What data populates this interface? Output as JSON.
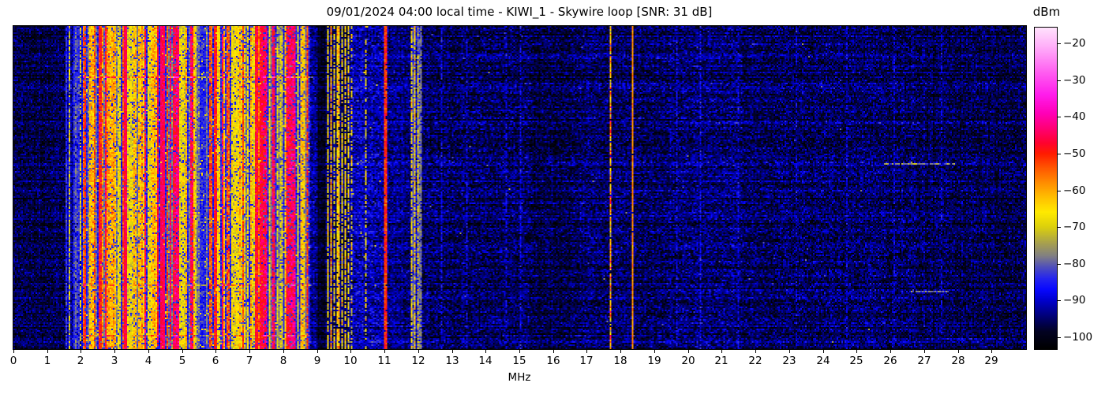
{
  "header": {
    "title": "09/01/2024 04:00 local time - KIWI_1 - Skywire loop [SNR: 31 dB]"
  },
  "chart_data": {
    "type": "heatmap",
    "title": "09/01/2024 04:00 local time - KIWI_1 - Skywire loop [SNR: 31 dB]",
    "subtitle": "",
    "xlabel": "MHz",
    "ylabel": "",
    "x_range": [
      0,
      30
    ],
    "x_ticks": [
      0,
      1,
      2,
      3,
      4,
      5,
      6,
      7,
      8,
      9,
      10,
      11,
      12,
      13,
      14,
      15,
      16,
      17,
      18,
      19,
      20,
      21,
      22,
      23,
      24,
      25,
      26,
      27,
      28,
      29
    ],
    "grid": false,
    "legend": "none",
    "colorbar": {
      "label": "dBm",
      "vmin": -103.2,
      "vmax": -15.7,
      "tick_values": [
        -20,
        -30,
        -40,
        -50,
        -60,
        -70,
        -80,
        -90,
        -100
      ],
      "tick_labels": [
        "−20",
        "−30",
        "−40",
        "−50",
        "−60",
        "−70",
        "−80",
        "−90",
        "−100"
      ]
    },
    "colormap_stops": [
      [
        -103.2,
        [
          0,
          0,
          0
        ]
      ],
      [
        -98.5,
        [
          2,
          2,
          34
        ]
      ],
      [
        -94,
        [
          0,
          0,
          125
        ]
      ],
      [
        -90,
        [
          0,
          0,
          205
        ]
      ],
      [
        -87,
        [
          8,
          8,
          255
        ]
      ],
      [
        -84,
        [
          38,
          38,
          238
        ]
      ],
      [
        -81,
        [
          78,
          78,
          188
        ]
      ],
      [
        -78,
        [
          128,
          126,
          132
        ]
      ],
      [
        -74,
        [
          172,
          165,
          72
        ]
      ],
      [
        -70,
        [
          220,
          208,
          12
        ]
      ],
      [
        -66,
        [
          255,
          234,
          0
        ]
      ],
      [
        -62,
        [
          255,
          192,
          0
        ]
      ],
      [
        -58,
        [
          255,
          142,
          0
        ]
      ],
      [
        -54,
        [
          255,
          88,
          0
        ]
      ],
      [
        -50,
        [
          255,
          28,
          0
        ]
      ],
      [
        -47,
        [
          255,
          2,
          48
        ]
      ],
      [
        -43,
        [
          255,
          0,
          118
        ]
      ],
      [
        -39,
        [
          255,
          0,
          183
        ]
      ],
      [
        -34,
        [
          255,
          28,
          235
        ]
      ],
      [
        -28,
        [
          255,
          92,
          240
        ]
      ],
      [
        -22,
        [
          255,
          162,
          248
        ]
      ],
      [
        -15.7,
        [
          255,
          226,
          252
        ]
      ]
    ],
    "seed": 1337,
    "bands": [
      {
        "f0": 0.0,
        "f1": 1.56,
        "kind": "noise",
        "base": -96.3,
        "noise": 3.1
      },
      {
        "f0": 1.56,
        "f1": 2.06,
        "kind": "cols",
        "base": -91,
        "noise": 3.2,
        "density": 0.5,
        "levels": [
          -86,
          -83,
          -80
        ]
      },
      {
        "f0": 2.06,
        "f1": 2.55,
        "kind": "busy",
        "density": 0.55,
        "hot": 0.4
      },
      {
        "f0": 2.55,
        "f1": 3.55,
        "kind": "busy",
        "density": 0.68,
        "hot": 0.7
      },
      {
        "f0": 3.55,
        "f1": 4.65,
        "kind": "busy",
        "density": 0.64,
        "hot": 0.65
      },
      {
        "f0": 4.65,
        "f1": 5.75,
        "kind": "busy",
        "density": 0.56,
        "hot": 0.3
      },
      {
        "f0": 5.75,
        "f1": 6.45,
        "kind": "busy",
        "density": 0.66,
        "hot": 0.5
      },
      {
        "f0": 6.45,
        "f1": 7.0,
        "kind": "busy",
        "density": 0.5,
        "hot": 0.4
      },
      {
        "f0": 7.0,
        "f1": 7.52,
        "kind": "busy",
        "density": 0.66,
        "hot": 0.8
      },
      {
        "f0": 7.52,
        "f1": 8.08,
        "kind": "busy",
        "density": 0.5,
        "hot": 0.35
      },
      {
        "f0": 8.08,
        "f1": 8.78,
        "kind": "busy",
        "density": 0.55,
        "hot": 0.5
      },
      {
        "f0": 8.78,
        "f1": 9.02,
        "kind": "noise",
        "base": -92.5,
        "noise": 3.4
      },
      {
        "f0": 9.02,
        "f1": 9.27,
        "kind": "noise",
        "base": -98.8,
        "noise": 2.2
      },
      {
        "f0": 9.27,
        "f1": 9.97,
        "kind": "noise",
        "base": -95.0,
        "noise": 3.0
      },
      {
        "f0": 9.97,
        "f1": 10.97,
        "kind": "noise",
        "base": -91.3,
        "noise": 4.0,
        "dash_prob": 0.004,
        "dash_level": -72
      },
      {
        "f0": 10.97,
        "f1": 11.78,
        "kind": "noise",
        "base": -93.2,
        "noise": 3.3
      },
      {
        "f0": 11.78,
        "f1": 12.12,
        "kind": "cols",
        "base": -89,
        "noise": 4.2,
        "density": 0.5,
        "levels": [
          -84,
          -81,
          -78
        ]
      },
      {
        "f0": 12.12,
        "f1": 15.35,
        "kind": "noise",
        "base": -95.3,
        "noise": 3.8,
        "dash_prob": 0.0012,
        "dash_level": -80
      },
      {
        "f0": 15.35,
        "f1": 16.65,
        "kind": "noise",
        "base": -96.8,
        "noise": 3.4
      },
      {
        "f0": 16.65,
        "f1": 19.4,
        "kind": "noise",
        "base": -95.5,
        "noise": 3.7,
        "dash_prob": 0.001,
        "dash_level": -80
      },
      {
        "f0": 19.4,
        "f1": 21.6,
        "kind": "noise",
        "base": -94.6,
        "noise": 3.9,
        "dash_prob": 0.0015,
        "dash_level": -82
      },
      {
        "f0": 21.6,
        "f1": 27.0,
        "kind": "noise",
        "base": -95.5,
        "noise": 3.7,
        "dash_prob": 0.001,
        "dash_level": -82
      },
      {
        "f0": 27.0,
        "f1": 30.01,
        "kind": "noise",
        "base": -96.3,
        "noise": 3.4
      }
    ],
    "vlines": [
      {
        "f": 1.64,
        "level": -71,
        "w": 1,
        "flick": 5,
        "gap": 0.3
      },
      {
        "f": 1.99,
        "level": -69,
        "w": 1,
        "flick": 5,
        "gap": 0.25
      },
      {
        "f": 2.57,
        "level": -49,
        "w": 2,
        "flick": 3,
        "gap": 0.05
      },
      {
        "f": 3.33,
        "level": -45.5,
        "w": 2,
        "flick": 2,
        "gap": 0.02
      },
      {
        "f": 4.4,
        "level": -45,
        "w": 3,
        "flick": 2,
        "gap": 0.02
      },
      {
        "f": 6.0,
        "level": -49,
        "w": 2,
        "flick": 3,
        "gap": 0.06
      },
      {
        "f": 7.21,
        "level": -48,
        "w": 2,
        "flick": 3,
        "gap": 0.05
      },
      {
        "f": 7.35,
        "level": -47,
        "w": 2,
        "flick": 3,
        "gap": 0.05
      },
      {
        "f": 9.31,
        "level": -66,
        "w": 1,
        "flick": 4,
        "gap": 0.15
      },
      {
        "f": 9.41,
        "level": -60,
        "w": 1,
        "flick": 4,
        "gap": 0.1
      },
      {
        "f": 9.49,
        "level": -68,
        "w": 1,
        "flick": 5,
        "gap": 0.3
      },
      {
        "f": 9.58,
        "level": -64,
        "w": 1,
        "flick": 4,
        "gap": 0.15
      },
      {
        "f": 9.67,
        "level": -62,
        "w": 1,
        "flick": 4,
        "gap": 0.1
      },
      {
        "f": 9.75,
        "level": -67,
        "w": 1,
        "flick": 5,
        "gap": 0.25
      },
      {
        "f": 9.83,
        "level": -65,
        "w": 1,
        "flick": 4,
        "gap": 0.2
      },
      {
        "f": 9.91,
        "level": -68,
        "w": 1,
        "flick": 5,
        "gap": 0.3
      },
      {
        "f": 10.04,
        "level": -70,
        "w": 1,
        "flick": 6,
        "gap": 0.45
      },
      {
        "f": 10.45,
        "level": -69,
        "w": 1,
        "flick": 6,
        "gap": 0.4
      },
      {
        "f": 11.04,
        "level": -51,
        "w": 2,
        "flick": 3,
        "gap": 0.03
      },
      {
        "f": 11.8,
        "level": -68,
        "w": 1,
        "flick": 5,
        "gap": 0.25
      },
      {
        "f": 11.9,
        "level": -66,
        "w": 1,
        "flick": 5,
        "gap": 0.2
      },
      {
        "f": 12.0,
        "level": -69,
        "w": 1,
        "flick": 6,
        "gap": 0.3
      },
      {
        "f": 12.69,
        "level": -88,
        "w": 1,
        "flick": 3,
        "gap": 0.3
      },
      {
        "f": 13.43,
        "level": -88.5,
        "w": 1,
        "flick": 3,
        "gap": 0.35
      },
      {
        "f": 14.58,
        "level": -89,
        "w": 1,
        "flick": 3,
        "gap": 0.4
      },
      {
        "f": 15.01,
        "level": -88.5,
        "w": 1,
        "flick": 3,
        "gap": 0.35
      },
      {
        "f": 17.67,
        "level": -60,
        "w": 1,
        "flick": 8,
        "gap": 0.1
      },
      {
        "f": 18.33,
        "level": -58,
        "w": 1,
        "flick": 2,
        "gap": 0.02
      },
      {
        "f": 19.63,
        "level": -88,
        "w": 1,
        "flick": 3,
        "gap": 0.35
      },
      {
        "f": 20.37,
        "level": -87.5,
        "w": 1,
        "flick": 3,
        "gap": 0.3
      },
      {
        "f": 21.47,
        "level": -88.5,
        "w": 1,
        "flick": 3,
        "gap": 0.4
      },
      {
        "f": 23.2,
        "level": -89,
        "w": 1,
        "flick": 3,
        "gap": 0.45
      },
      {
        "f": 24.7,
        "level": -89,
        "w": 1,
        "flick": 3,
        "gap": 0.45
      },
      {
        "f": 26.1,
        "level": -89,
        "w": 1,
        "flick": 3,
        "gap": 0.5
      },
      {
        "f": 27.5,
        "level": -89,
        "w": 1,
        "flick": 3,
        "gap": 0.5
      }
    ],
    "hstreaks": [
      {
        "y": 0.158,
        "f0": 1.85,
        "f1": 8.9,
        "boost": 13,
        "prob": 0.85
      },
      {
        "y": 0.162,
        "f0": 8.9,
        "f1": 12.1,
        "boost": 6,
        "prob": 0.5
      },
      {
        "y": 0.44,
        "f0": 2.0,
        "f1": 8.85,
        "boost": 6,
        "prob": 0.5
      },
      {
        "y": 0.805,
        "f0": 2.0,
        "f1": 8.85,
        "boost": 9,
        "prob": 0.7
      },
      {
        "y": 0.962,
        "f0": 2.0,
        "f1": 8.85,
        "boost": 9,
        "prob": 0.7
      },
      {
        "y": 0.03,
        "f0": 12.1,
        "f1": 30,
        "boost": 5,
        "prob": 0.55
      },
      {
        "y": 0.055,
        "f0": 15,
        "f1": 25,
        "boost": 5,
        "prob": 0.5
      },
      {
        "y": 0.098,
        "f0": 12.1,
        "f1": 21.5,
        "boost": 6,
        "prob": 0.6
      },
      {
        "y": 0.175,
        "f0": 13.5,
        "f1": 30,
        "boost": 5,
        "prob": 0.5
      },
      {
        "y": 0.285,
        "f0": 12.1,
        "f1": 20,
        "boost": 6,
        "prob": 0.55
      },
      {
        "y": 0.3,
        "f0": 20,
        "f1": 30,
        "boost": 4,
        "prob": 0.45
      },
      {
        "y": 0.42,
        "f0": 9.97,
        "f1": 30,
        "boost": 6,
        "prob": 0.5
      },
      {
        "y": 0.425,
        "f0": 25.8,
        "f1": 27.9,
        "boost": 17,
        "prob": 0.75
      },
      {
        "y": 0.55,
        "f0": 12.1,
        "f1": 24,
        "boost": 5,
        "prob": 0.5
      },
      {
        "y": 0.655,
        "f0": 16.5,
        "f1": 30,
        "boost": 5,
        "prob": 0.5
      },
      {
        "y": 0.7,
        "f0": 12.1,
        "f1": 18,
        "boost": 4,
        "prob": 0.45
      },
      {
        "y": 0.82,
        "f0": 19,
        "f1": 28.2,
        "boost": 6,
        "prob": 0.5
      },
      {
        "y": 0.825,
        "f0": 26.3,
        "f1": 27.7,
        "boost": 15,
        "prob": 0.75
      },
      {
        "y": 0.9,
        "f0": 12.1,
        "f1": 22,
        "boost": 5,
        "prob": 0.5
      },
      {
        "y": 0.962,
        "f0": 12.5,
        "f1": 19.5,
        "boost": 6,
        "prob": 0.55
      },
      {
        "y": 0.97,
        "f0": 27,
        "f1": 30,
        "boost": 6,
        "prob": 0.6
      }
    ]
  }
}
